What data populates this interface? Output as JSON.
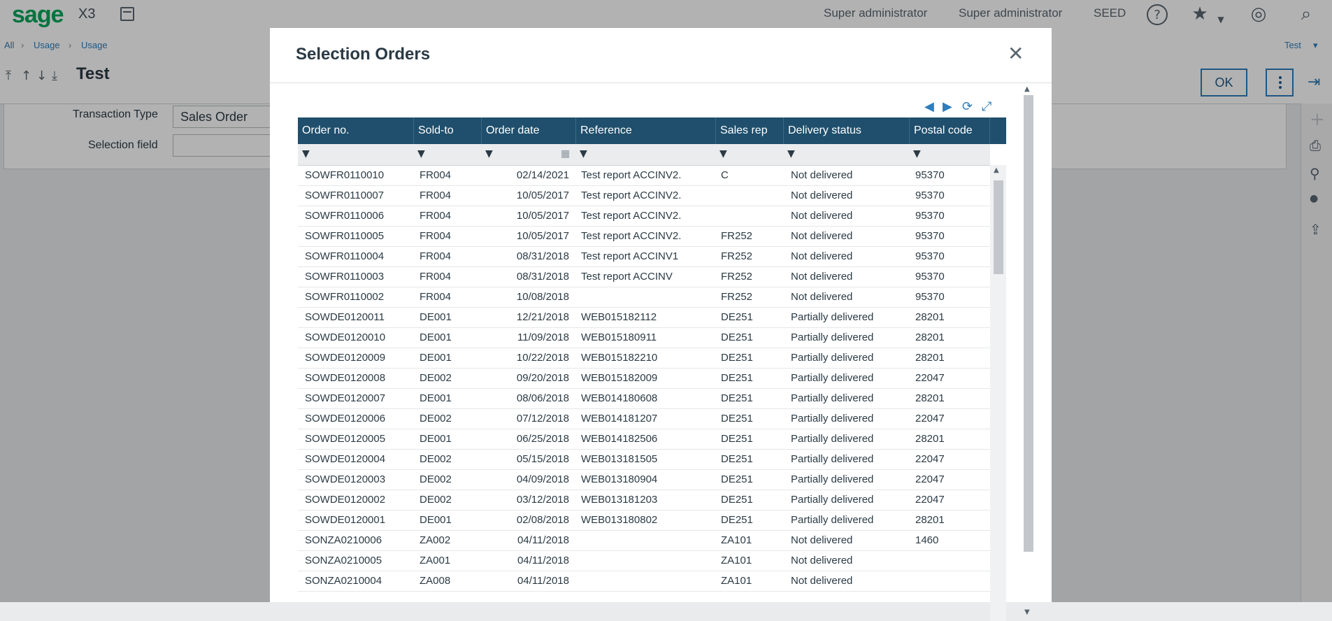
{
  "app": {
    "logo": "sage",
    "product": "X3",
    "user_role": "Super administrator",
    "user_name": "Super administrator",
    "folder": "SEED",
    "help_icon": "?",
    "star_icon": "★",
    "compass_icon": "◎",
    "search_icon": "⌕"
  },
  "breadcrumb": {
    "items": [
      "All",
      "Usage",
      "Usage"
    ],
    "sep": "›",
    "right_label": "Test",
    "right_caret": "▾"
  },
  "page": {
    "title": "Test",
    "nav_first": "⤒",
    "nav_prev": "↑",
    "nav_next": "↓",
    "nav_last": "⤓",
    "ok_label": "OK",
    "exit_icon": "⇥"
  },
  "form": {
    "transaction_type_label": "Transaction Type",
    "transaction_type_value": "Sales Order",
    "selection_field_label": "Selection field",
    "selection_field_value": ""
  },
  "rail": {
    "add_icon": "+",
    "print_icon": "⎙",
    "attach_icon": "⚲",
    "comment_icon": "●",
    "export_icon": "⇪"
  },
  "modal": {
    "title": "Selection Orders",
    "close_icon": "✕",
    "prev_icon": "◀",
    "next_icon": "▶",
    "refresh_icon": "⟳",
    "expand_icon": "⤢",
    "filter_icon": "▼",
    "date_picker_icon": "▦",
    "columns": [
      "Order no.",
      "Sold-to",
      "Order date",
      "Reference",
      "Sales rep",
      "Delivery status",
      "Postal code"
    ],
    "rows": [
      [
        "SOWFR0110010",
        "FR004",
        "02/14/2021",
        "Test report ACCINV2.",
        "C",
        "Not delivered",
        "95370"
      ],
      [
        "SOWFR0110007",
        "FR004",
        "10/05/2017",
        "Test report ACCINV2.",
        "",
        "Not delivered",
        "95370"
      ],
      [
        "SOWFR0110006",
        "FR004",
        "10/05/2017",
        "Test report ACCINV2.",
        "",
        "Not delivered",
        "95370"
      ],
      [
        "SOWFR0110005",
        "FR004",
        "10/05/2017",
        "Test report ACCINV2.",
        "FR252",
        "Not delivered",
        "95370"
      ],
      [
        "SOWFR0110004",
        "FR004",
        "08/31/2018",
        "Test report ACCINV1",
        "FR252",
        "Not delivered",
        "95370"
      ],
      [
        "SOWFR0110003",
        "FR004",
        "08/31/2018",
        "Test report ACCINV",
        "FR252",
        "Not delivered",
        "95370"
      ],
      [
        "SOWFR0110002",
        "FR004",
        "10/08/2018",
        "",
        "FR252",
        "Not delivered",
        "95370"
      ],
      [
        "SOWDE0120011",
        "DE001",
        "12/21/2018",
        "WEB015182112",
        "DE251",
        "Partially delivered",
        "28201"
      ],
      [
        "SOWDE0120010",
        "DE001",
        "11/09/2018",
        "WEB015180911",
        "DE251",
        "Partially delivered",
        "28201"
      ],
      [
        "SOWDE0120009",
        "DE001",
        "10/22/2018",
        "WEB015182210",
        "DE251",
        "Partially delivered",
        "28201"
      ],
      [
        "SOWDE0120008",
        "DE002",
        "09/20/2018",
        "WEB015182009",
        "DE251",
        "Partially delivered",
        "22047"
      ],
      [
        "SOWDE0120007",
        "DE001",
        "08/06/2018",
        "WEB014180608",
        "DE251",
        "Partially delivered",
        "28201"
      ],
      [
        "SOWDE0120006",
        "DE002",
        "07/12/2018",
        "WEB014181207",
        "DE251",
        "Partially delivered",
        "22047"
      ],
      [
        "SOWDE0120005",
        "DE001",
        "06/25/2018",
        "WEB014182506",
        "DE251",
        "Partially delivered",
        "28201"
      ],
      [
        "SOWDE0120004",
        "DE002",
        "05/15/2018",
        "WEB013181505",
        "DE251",
        "Partially delivered",
        "22047"
      ],
      [
        "SOWDE0120003",
        "DE002",
        "04/09/2018",
        "WEB013180904",
        "DE251",
        "Partially delivered",
        "22047"
      ],
      [
        "SOWDE0120002",
        "DE002",
        "03/12/2018",
        "WEB013181203",
        "DE251",
        "Partially delivered",
        "22047"
      ],
      [
        "SOWDE0120001",
        "DE001",
        "02/08/2018",
        "WEB013180802",
        "DE251",
        "Partially delivered",
        "28201"
      ],
      [
        "SONZA0210006",
        "ZA002",
        "04/11/2018",
        "",
        "ZA101",
        "Not delivered",
        "1460"
      ],
      [
        "SONZA0210005",
        "ZA001",
        "04/11/2018",
        "",
        "ZA101",
        "Not delivered",
        ""
      ],
      [
        "SONZA0210004",
        "ZA008",
        "04/11/2018",
        "",
        "ZA101",
        "Not delivered",
        ""
      ]
    ]
  }
}
